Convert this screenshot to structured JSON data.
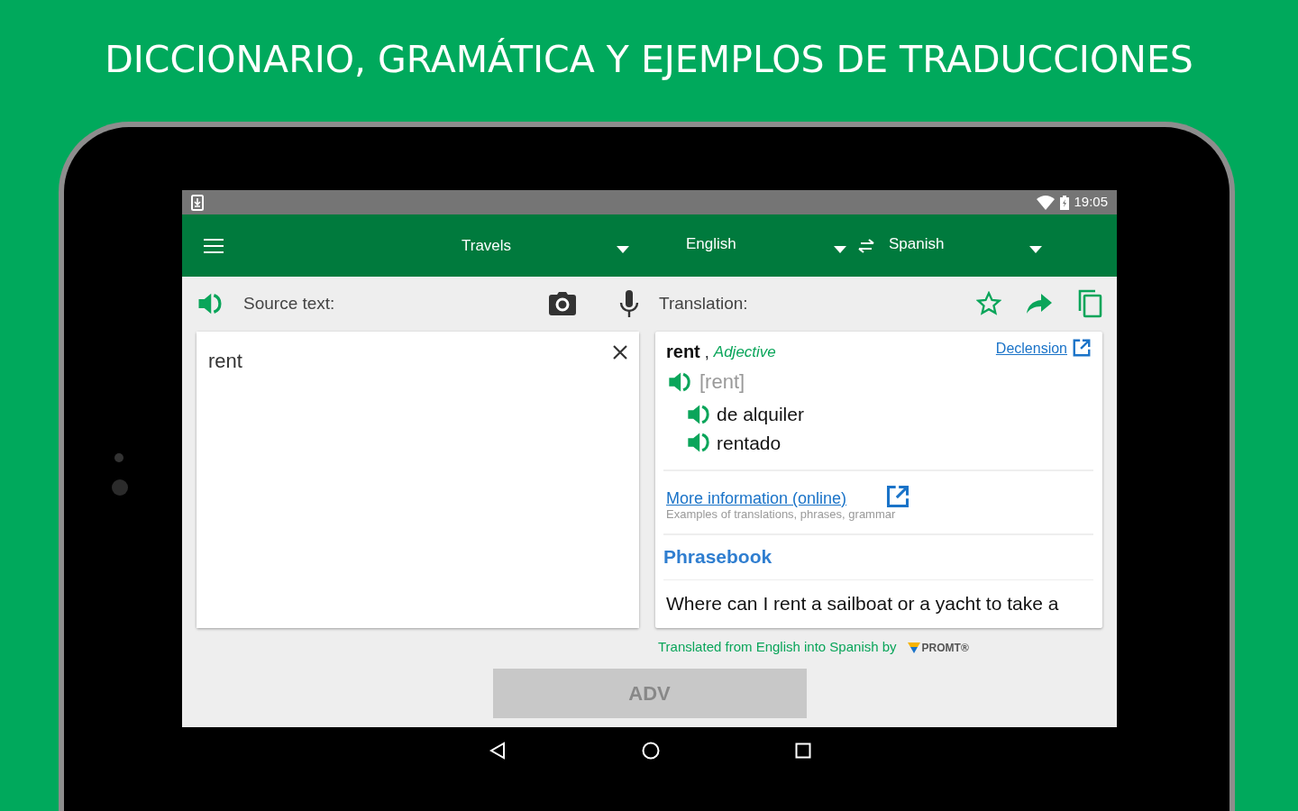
{
  "headline": "DICCIONARIO, GRAMÁTICA Y EJEMPLOS DE TRADUCCIONES",
  "status_bar": {
    "time": "19:05"
  },
  "toolbar": {
    "topic": "Travels",
    "source_language": "English",
    "target_language": "Spanish"
  },
  "source": {
    "label": "Source text:",
    "value": "rent"
  },
  "translation": {
    "label": "Translation:",
    "favorite": false
  },
  "entry": {
    "word": "rent",
    "separator": ",",
    "part_of_speech": "Adjective",
    "declension_link": "Declension",
    "transcription": "[rent]",
    "meanings": [
      "de alquiler",
      "rentado"
    ]
  },
  "more_info": {
    "link": "More information (online)",
    "caption": "Examples of translations, phrases, grammar"
  },
  "phrasebook": {
    "title": "Phrasebook",
    "phrases": [
      "Where can I rent a sailboat or a yacht to take a"
    ]
  },
  "credit": {
    "text": "Translated from English into Spanish by",
    "brand": "PROMT®"
  },
  "ad_button": "ADV"
}
